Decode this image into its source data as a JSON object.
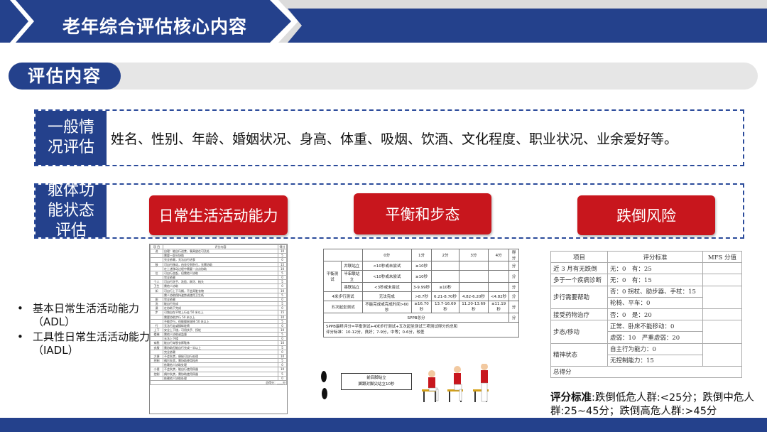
{
  "header": {
    "title": "老年综合评估核心内容"
  },
  "section": {
    "label": "评估内容"
  },
  "general": {
    "label_line1": "一般情",
    "label_line2": "况评估",
    "content": "姓名、性别、年龄、婚姻状况、身高、体重、吸烟、饮酒、文化程度、职业状况、业余爱好等。"
  },
  "functional": {
    "label_line1": "躯体功",
    "label_line2": "能状态",
    "label_line3": "评估",
    "buttons": [
      "日常生活活动能力",
      "平衡和步态",
      "跌倒风险"
    ]
  },
  "bullets": [
    "基本日常生活活动能力（ADL）",
    "工具性日常生活活动能力（IADL）"
  ],
  "adl_table": {
    "headers": [
      "项 目",
      "评分内容",
      "得分"
    ],
    "rows": [
      [
        "进",
        "自理：能自行进食，餐具放在可及处",
        "10"
      ],
      [
        "",
        "需要一部分协助",
        "5"
      ],
      [
        "",
        "完全依赖，无法自行进食",
        "0"
      ],
      [
        "移",
        "可自行移动，由坐位到卧位，无需协助",
        "15"
      ],
      [
        "",
        "在上述移动过程中需要一点点协助",
        "10"
      ],
      [
        "位",
        "可自行坐起，但需他人协助",
        "5"
      ],
      [
        "",
        "完全依赖",
        "0"
      ],
      [
        "个人",
        "可自行洗手、洗脸、刷牙、梳头",
        "5"
      ],
      [
        "卫生",
        "需他人协助",
        "0"
      ],
      [
        "如",
        "可自行上下马桶，不会弄脏衣物",
        "10"
      ],
      [
        "",
        "需人协助保持姿势或使用卫生纸",
        "5"
      ],
      [
        "厕",
        "完全依赖",
        "0"
      ],
      [
        "洗",
        "能自行完成",
        "5"
      ],
      [
        "澡",
        "在协助下完成",
        "0"
      ],
      [
        "步",
        "可独自在平地上行走 50 米以上",
        "15"
      ],
      [
        "",
        "需要协助步行 50 米以上",
        "10"
      ],
      [
        "",
        "不能步行，但能操纵轮椅 50 米以上",
        "5"
      ],
      [
        "行",
        "无法行走或操纵轮椅",
        "0"
      ],
      [
        "上下",
        "安全上下楼，可用扶手、拐杖",
        "10"
      ],
      [
        "楼梯",
        "需他人协助或监督",
        "5"
      ],
      [
        "",
        "无法上下楼",
        "0"
      ],
      [
        "穿脱",
        "能自行穿脱衣裤鞋袜",
        "10"
      ],
      [
        "衣服",
        "需协助但能自行完成一半以上",
        "5"
      ],
      [
        "",
        "完全依赖",
        "0"
      ],
      [
        "大便",
        "不会失禁，便秘可自行处理",
        "10"
      ],
      [
        "控制",
        "偶尔失禁，需协助使用栓剂",
        "5"
      ],
      [
        "",
        "依赖他人协助处理",
        "0"
      ],
      [
        "小便",
        "不会失禁，能自行使用尿器",
        "10"
      ],
      [
        "控制",
        "偶尔失禁，需协助使用尿器",
        "5"
      ],
      [
        "",
        "依赖他人协助处理",
        "0"
      ]
    ],
    "footer": "总得分：____分"
  },
  "sppb_table": {
    "headers": [
      "",
      "",
      "0分",
      "1分",
      "2分",
      "3分",
      "4分",
      "得分"
    ],
    "balance_label": "平衡测试",
    "balance_rows": [
      [
        "并联站立",
        "<10秒或未尝试",
        "≥10秒",
        "",
        "",
        "",
        "分"
      ],
      [
        "半串联站立",
        "<10秒或未尝试",
        "≥10秒",
        "",
        "",
        "",
        "分"
      ],
      [
        "串联站立",
        "<3秒或未尝试",
        "3-9.99秒",
        "≥10秒",
        "",
        "",
        "分"
      ]
    ],
    "walk": [
      "4米步行测试",
      "无法完成",
      ">8.7秒",
      "6.21-8.70秒",
      "4.82-6.20秒",
      "<4.82秒",
      "分"
    ],
    "chair": [
      "五次起坐测试",
      "不能完成或完成时间>60秒",
      "≥16.70秒",
      "13.7-16.69秒",
      "11.20-13.69秒",
      "≤11.19秒",
      "分"
    ],
    "total": [
      "SPPB总分",
      "分"
    ],
    "note1": "SPPB最终评分=平衡测试+4米步行测试+五次起坐测试三项测试得分的总和",
    "note2": "评分标准：10-12分，良好；7-9分，中等；0-6分，较差",
    "figure_caption_1": "前后脚站立",
    "figure_caption_2": "脚跟对脚尖站立10秒"
  },
  "mfs_table": {
    "headers": [
      "项目",
      "评分标准",
      "MFS 分值"
    ],
    "rows": [
      {
        "item": "近 3 月有无跌倒",
        "criteria": [
          "无：0　有：25"
        ]
      },
      {
        "item": "多于一个疾病诊断",
        "criteria": [
          "无：0　有：15"
        ]
      },
      {
        "item": "步行需要帮助",
        "criteria": [
          "否：0 拐杖、助步器、手杖：15",
          "轮椅、平车：0"
        ]
      },
      {
        "item": "接受药物治疗",
        "criteria": [
          "否：0　是：20"
        ]
      },
      {
        "item": "步态/移动",
        "criteria": [
          "正常、卧床不能移动：0",
          "虚弱：10　严重虚弱：20"
        ]
      },
      {
        "item": "精神状态",
        "criteria": [
          "自主行为能力：0",
          "无控制能力：15"
        ]
      }
    ],
    "total": "总得分"
  },
  "mfs_note": {
    "label": "评分标准",
    "text": ":跌倒低危人群:<25分；跌倒中危人群:25~45分；跌倒高危人群:>45分"
  },
  "colors": {
    "primary": "#24418c",
    "accent_red": "#c8161d"
  }
}
